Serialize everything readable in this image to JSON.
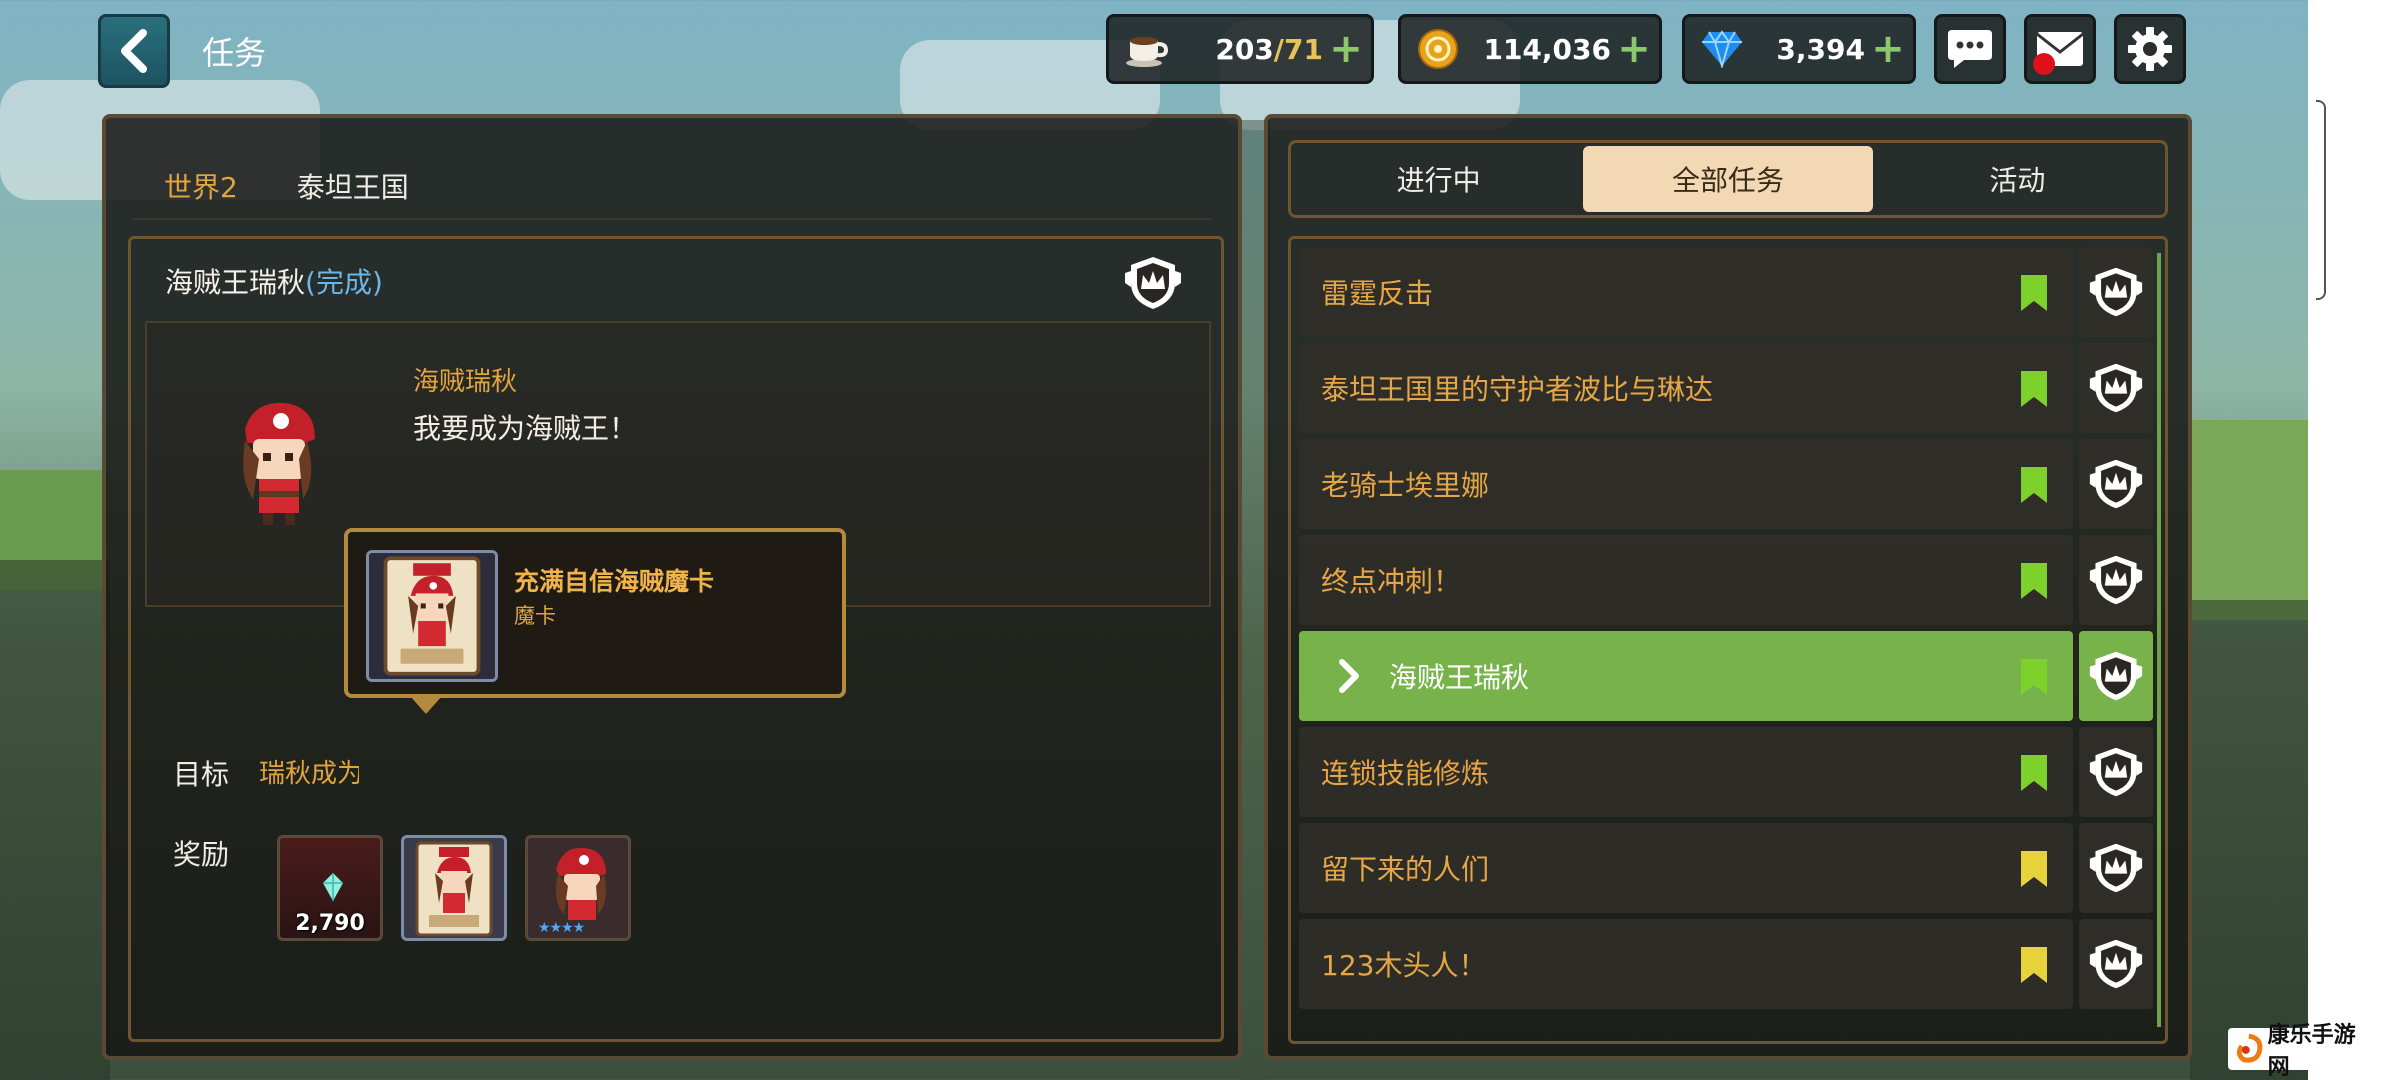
{
  "header": {
    "title": "任务",
    "stamina": {
      "current": "203",
      "max": "/71"
    },
    "gold": "114,036",
    "gems": "3,394",
    "plus": "+"
  },
  "left": {
    "world_label": "世界2",
    "kingdom": "泰坦王国",
    "quest_title": "海贼王瑞秋",
    "quest_status": "(完成)",
    "npc_name": "海贼瑞秋",
    "npc_line": "我要成为海贼王！",
    "goal_label": "目标",
    "goal_text": "瑞秋成为",
    "reward_label": "奖励",
    "rewards": [
      {
        "type": "gem",
        "amount": "2,790"
      },
      {
        "type": "card"
      },
      {
        "type": "character",
        "stars": "★★★★"
      }
    ],
    "tooltip": {
      "name": "充满自信海贼魔卡",
      "type": "魔卡"
    }
  },
  "tabs": [
    {
      "label": "进行中",
      "active": false
    },
    {
      "label": "全部任务",
      "active": true
    },
    {
      "label": "活动",
      "active": false
    }
  ],
  "quests": [
    {
      "name": "雷霆反击",
      "flag": "green"
    },
    {
      "name": "泰坦王国里的守护者波比与琳达",
      "flag": "green"
    },
    {
      "name": "老骑士埃里娜",
      "flag": "green"
    },
    {
      "name": "终点冲刺！",
      "flag": "green"
    },
    {
      "name": "海贼王瑞秋",
      "flag": "green",
      "selected": true
    },
    {
      "name": "连锁技能修炼",
      "flag": "green"
    },
    {
      "name": "留下来的人们",
      "flag": "yellow"
    },
    {
      "name": "123木头人！",
      "flag": "yellow"
    }
  ],
  "colors": {
    "accent_orange": "#e0a53e",
    "selected_green": "#77b34a",
    "flag_green": "#7cd12a",
    "flag_yellow": "#e8d23a",
    "status_blue": "#6ab6e8"
  },
  "watermark": "康乐手游网"
}
